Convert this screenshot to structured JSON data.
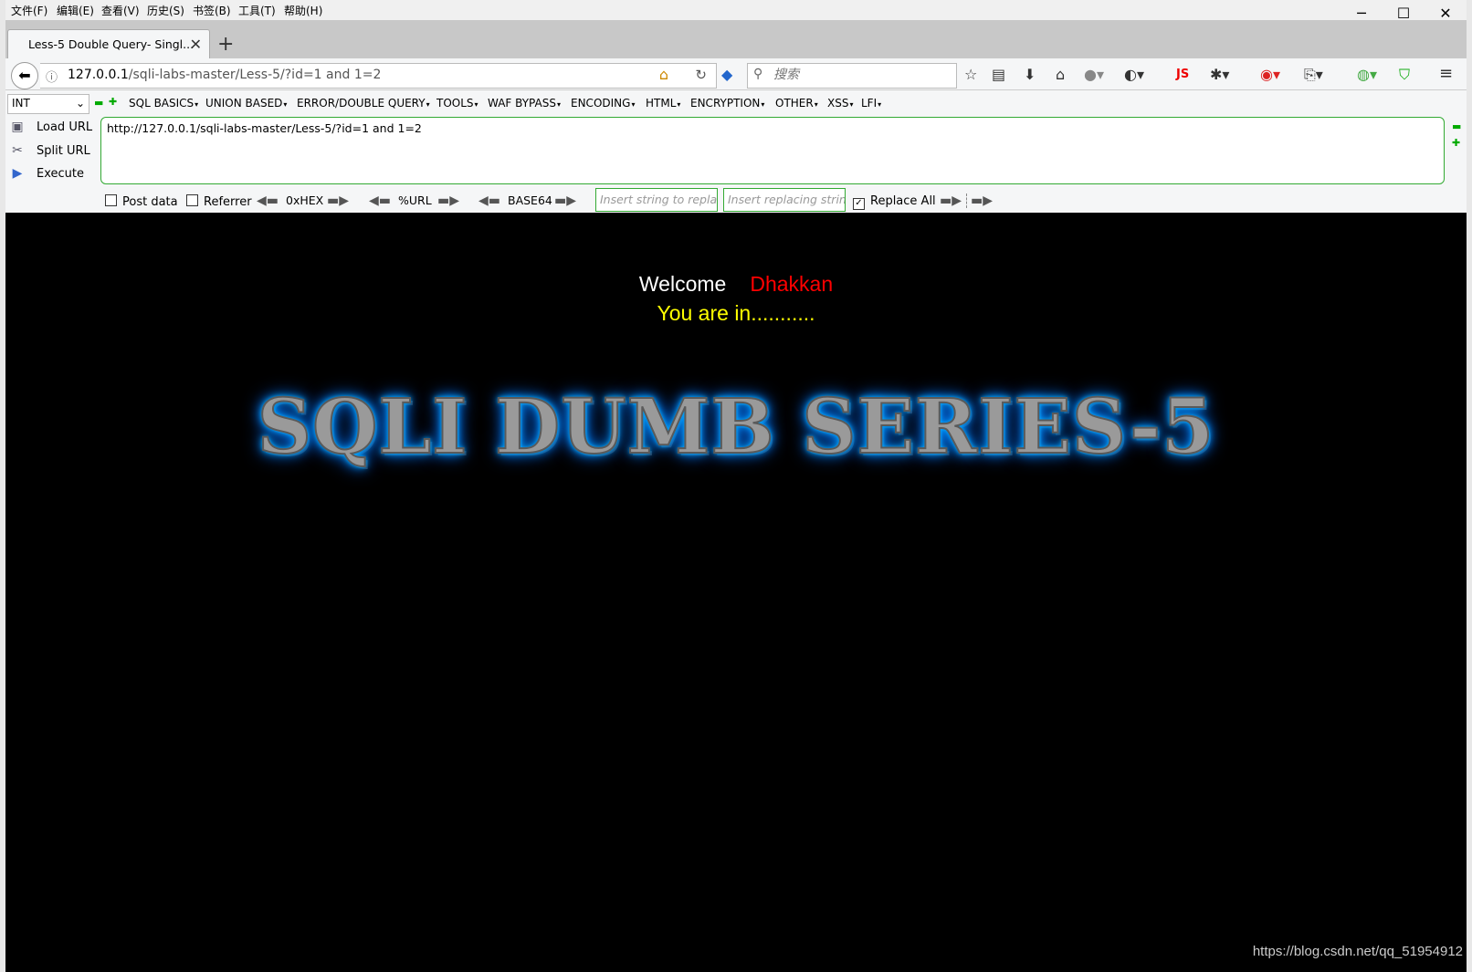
{
  "menubar": {
    "items": [
      "文件(F)",
      "编辑(E)",
      "查看(V)",
      "历史(S)",
      "书签(B)",
      "工具(T)",
      "帮助(H)"
    ]
  },
  "window_controls": {
    "minimize": "─",
    "maximize": "☐",
    "close": "✕"
  },
  "tab": {
    "title": "Less-5 Double Query- Singl...",
    "close": "✕",
    "new_tab": "+"
  },
  "navbar": {
    "url_host": "127.0.0.1",
    "url_path": "/sqli-labs-master/Less-5/?id=1 and 1=2",
    "search_placeholder": "搜索",
    "js_label": "JS"
  },
  "hackbar": {
    "select_value": "INT",
    "menus": [
      "SQL BASICS",
      "UNION BASED",
      "ERROR/DOUBLE QUERY",
      "TOOLS",
      "WAF BYPASS",
      "ENCODING",
      "HTML",
      "ENCRYPTION",
      "OTHER",
      "XSS",
      "LFI"
    ],
    "actions": {
      "load": "Load URL",
      "split": "Split URL",
      "execute": "Execute"
    },
    "url_value": "http://127.0.0.1/sqli-labs-master/Less-5/?id=1 and 1=2",
    "post_data": "Post data",
    "referrer": "Referrer",
    "hex": "0xHEX",
    "url_enc": "%URL",
    "base64": "BASE64",
    "replace_placeholder": "Insert string to replace",
    "replacing_placeholder": "Insert replacing string",
    "replace_all": "Replace All",
    "replace_all_checked": true
  },
  "content": {
    "welcome": "Welcome",
    "name": "Dhakkan",
    "status": "You are in...........",
    "title": "SQLI DUMB SERIES-5"
  },
  "watermark": "https://blog.csdn.net/qq_51954912"
}
